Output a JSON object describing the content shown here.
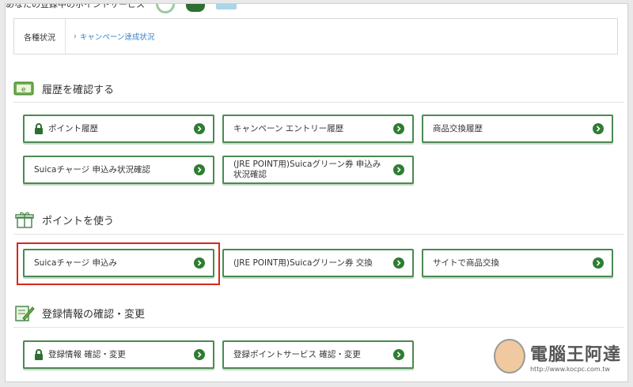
{
  "top_clip_text": "あなたの登録中のポイントサービス",
  "status": {
    "label": "各種状況",
    "link": "キャンペーン達成状況",
    "link_glyph": "›"
  },
  "sections": {
    "history": {
      "title": "履歴を確認する",
      "icon": "e-card-icon",
      "buttons": [
        "ポイント履歴",
        "キャンペーン エントリー履歴",
        "商品交換履歴",
        "Suicaチャージ 申込み状況確認",
        "(JRE POINT用)Suicaグリーン券 申込み状況確認"
      ]
    },
    "use": {
      "title": "ポイントを使う",
      "icon": "gift-icon",
      "buttons": [
        "Suicaチャージ 申込み",
        "(JRE POINT用)Suicaグリーン券 交換",
        "サイトで商品交換"
      ]
    },
    "register": {
      "title": "登録情報の確認・変更",
      "icon": "pencil-paper-icon",
      "buttons": [
        "登録情報 確認・変更",
        "登録ポイントサービス 確認・変更"
      ]
    }
  },
  "watermark": {
    "main": "電腦王阿達",
    "url": "http://www.kocpc.com.tw"
  },
  "colors": {
    "accent_green": "#2e7d32",
    "border_green": "#4a8a52",
    "link_blue": "#3a82c4",
    "highlight_red": "#d9261c"
  }
}
